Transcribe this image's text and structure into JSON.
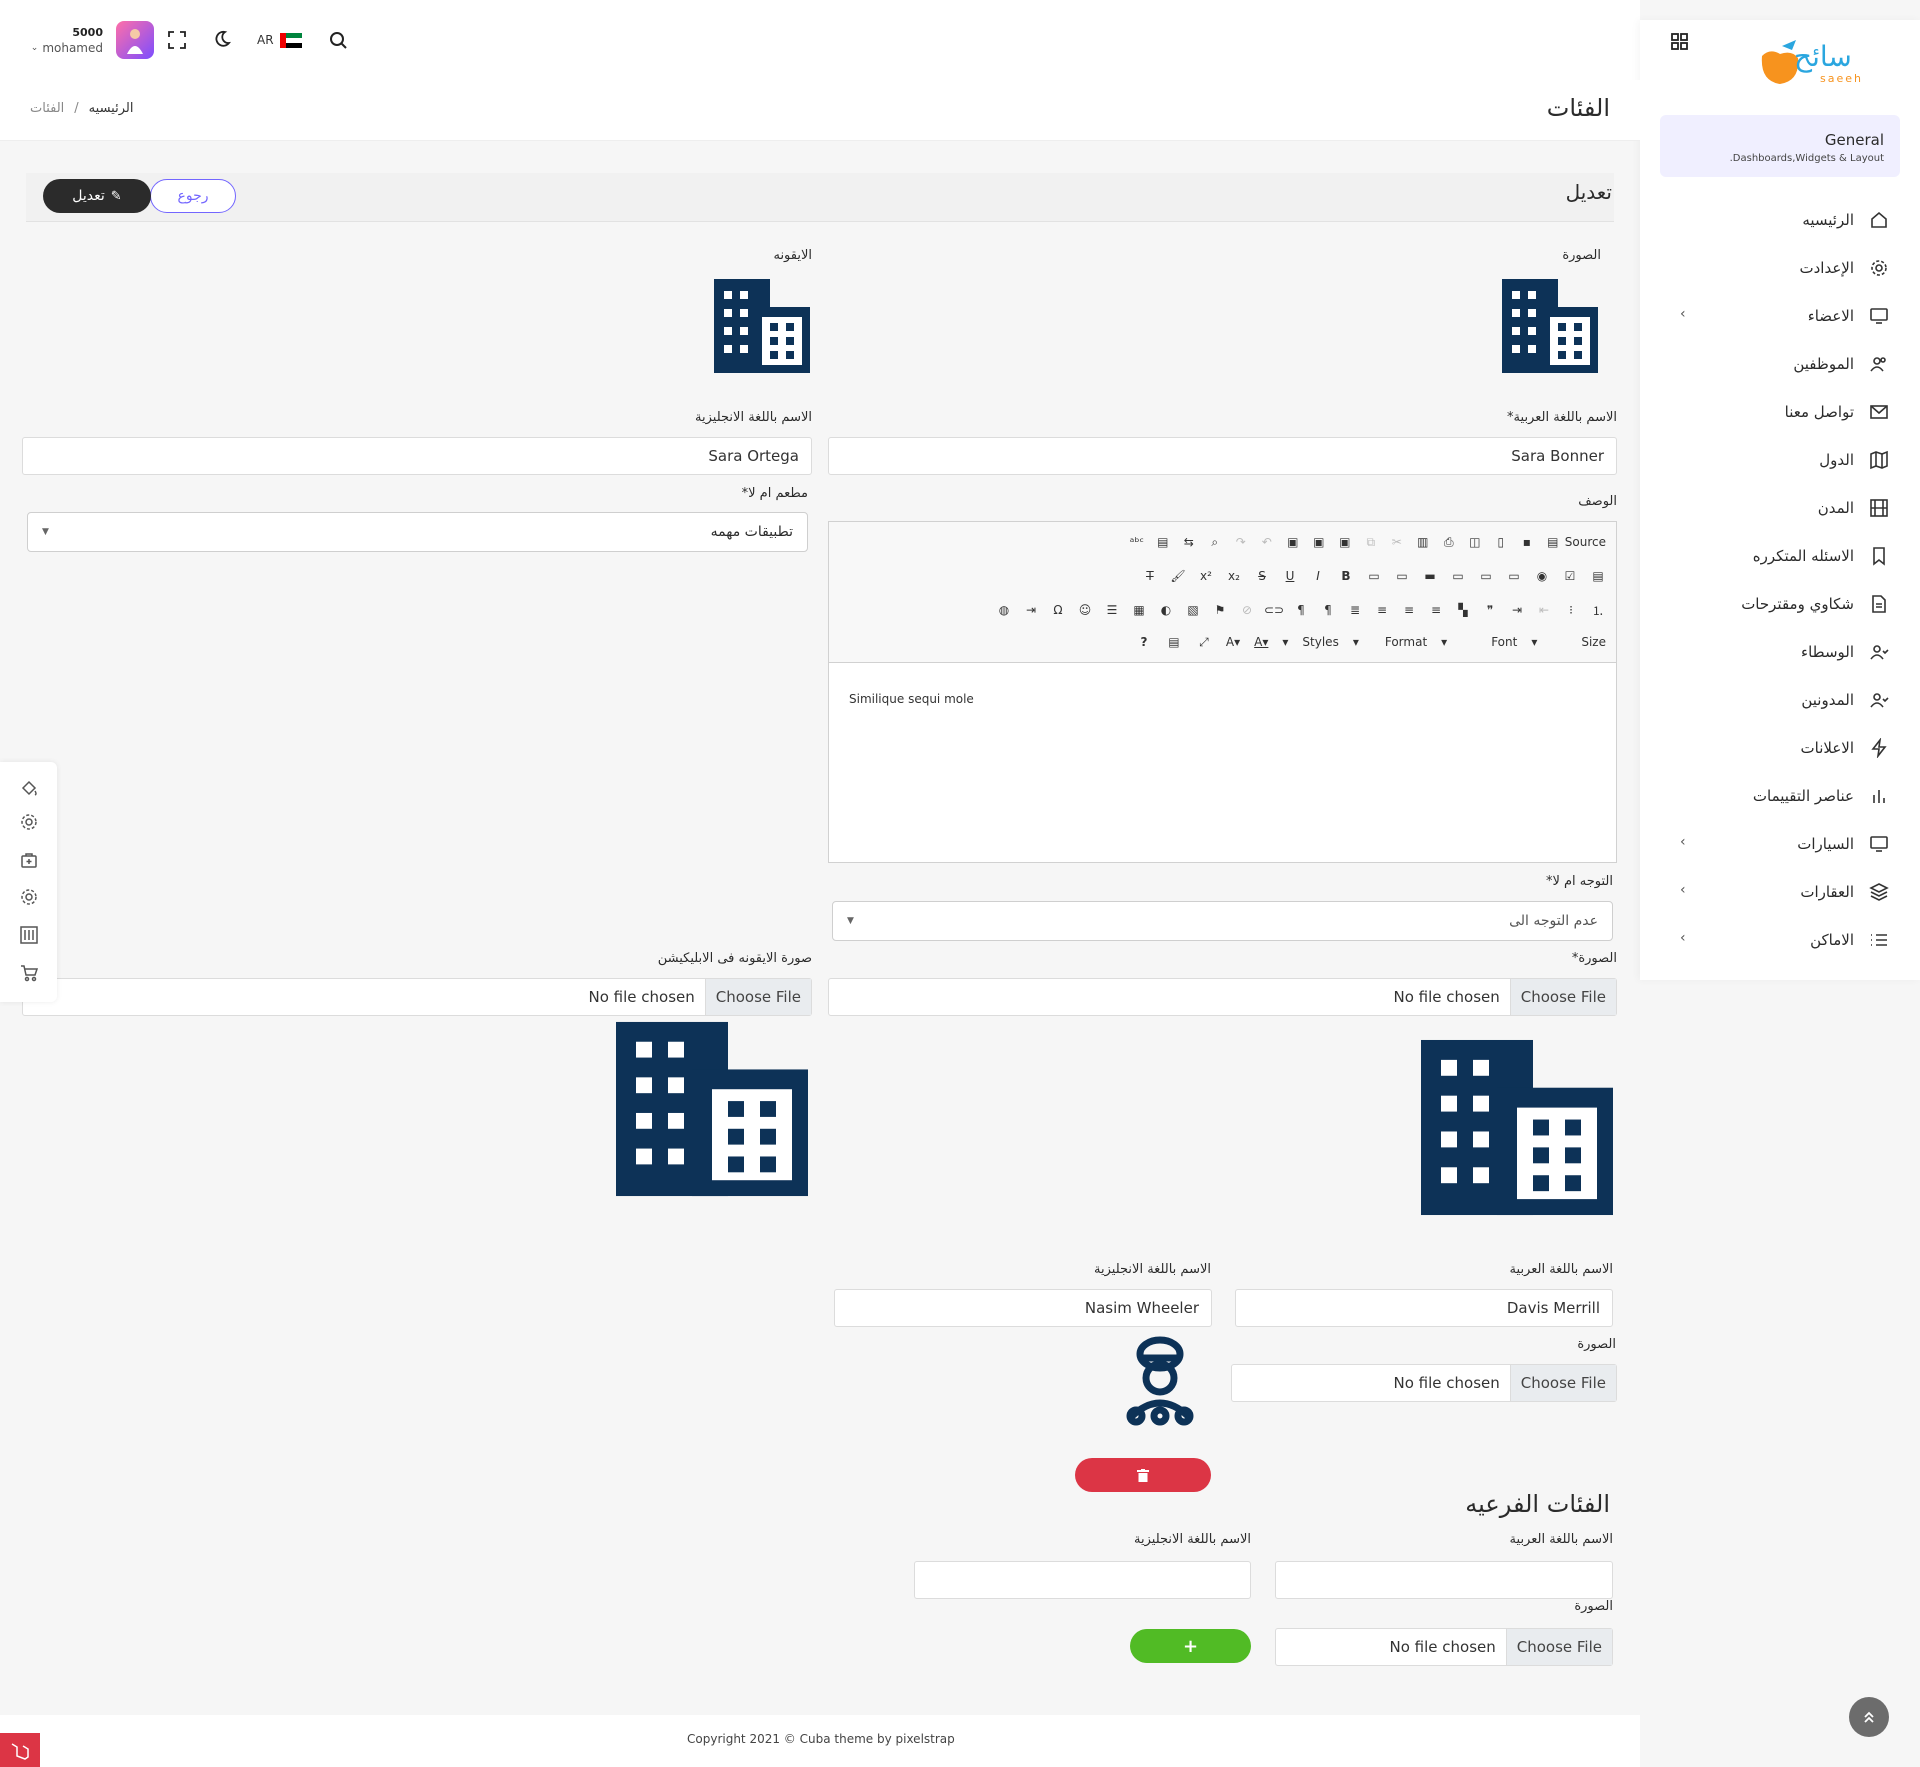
{
  "header": {
    "user_role": "5000",
    "user_name": "mohamed",
    "lang": "AR"
  },
  "logo": {
    "text": "سائح",
    "subtext": "saeeh"
  },
  "sidebar": {
    "section_title": "General",
    "section_subtitle": "Dashboards,Widgets & Layout.",
    "items": [
      {
        "label": "الرئيسيه",
        "icon": "home-icon",
        "chevron": false
      },
      {
        "label": "الإعدادت",
        "icon": "gear-icon",
        "chevron": false
      },
      {
        "label": "الاعضاء",
        "icon": "monitor-icon",
        "chevron": true
      },
      {
        "label": "الموظفين",
        "icon": "users-icon",
        "chevron": false
      },
      {
        "label": "تواصل معنا",
        "icon": "mail-icon",
        "chevron": false
      },
      {
        "label": "الدول",
        "icon": "map-icon",
        "chevron": false
      },
      {
        "label": "المدن",
        "icon": "film-icon",
        "chevron": false
      },
      {
        "label": "الاسئله المتكرره",
        "icon": "bookmark-icon",
        "chevron": false
      },
      {
        "label": "شكاوي ومقترحات",
        "icon": "file-icon",
        "chevron": false
      },
      {
        "label": "الوسطاء",
        "icon": "user-check-icon",
        "chevron": false
      },
      {
        "label": "المدونين",
        "icon": "user-check-icon",
        "chevron": false
      },
      {
        "label": "الاعلانات",
        "icon": "zap-icon",
        "chevron": false
      },
      {
        "label": "عناصر التقييمات",
        "icon": "bar-chart-icon",
        "chevron": false
      },
      {
        "label": "السيارات",
        "icon": "monitor-icon",
        "chevron": true
      },
      {
        "label": "العقارات",
        "icon": "layers-icon",
        "chevron": true
      },
      {
        "label": "الاماكن",
        "icon": "list-icon",
        "chevron": true
      }
    ]
  },
  "page": {
    "title": "الفئات",
    "breadcrumb_home": "الرئيسيه",
    "breadcrumb_sep": "/",
    "breadcrumb_current": "الفئات"
  },
  "card": {
    "title": "تعديل",
    "edit_button": "تعديل",
    "back_button": "رجوع"
  },
  "form": {
    "image_label": "الصورة",
    "icon_label": "الايقونه",
    "name_ar_label": "الاسم باللغة العربية*",
    "name_ar_value": "Sara Bonner",
    "name_en_label": "الاسم باللغة الانجليزية",
    "name_en_value": "Sara Ortega",
    "desc_label": "الوصف",
    "restaurant_label": "مطعم ام لا*",
    "restaurant_value": "تطبيقات مهمه",
    "direction_label": "التوجه ام لا*",
    "direction_value": "عدم التوجه الى",
    "photo_label": "الصورة*",
    "app_icon_label": "صورة الايقونه فى الابليكيشن",
    "choose_file": "Choose File",
    "no_file": "No file chosen",
    "editor_text": "Similique sequi mole"
  },
  "editor": {
    "source": "Source",
    "styles": "Styles",
    "format": "Format",
    "font": "Font",
    "size": "Size"
  },
  "sub_entry": {
    "name_ar_label": "الاسم باللغة العربية",
    "name_ar_value": "Davis Merrill",
    "name_en_label": "الاسم باللغة الانجليزية",
    "name_en_value": "Nasim Wheeler",
    "image_label": "الصورة",
    "choose_file": "Choose File",
    "no_file": "No file chosen"
  },
  "subcategories": {
    "title": "الفئات الفرعيه",
    "name_ar_label": "الاسم باللغة العربية",
    "name_en_label": "الاسم باللغة الانجليزية",
    "image_label": "الصورة",
    "choose_file": "Choose File",
    "no_file": "No file chosen",
    "add_label": "+"
  },
  "footer": {
    "copyright": "Copyright 2021 © Cuba theme by pixelstrap"
  },
  "colors": {
    "accent": "#7366ff",
    "dark": "#2b2b2b",
    "danger": "#dc3545",
    "success": "#51bb25",
    "building": "#0d3257",
    "logo_orange": "#f7931e"
  }
}
